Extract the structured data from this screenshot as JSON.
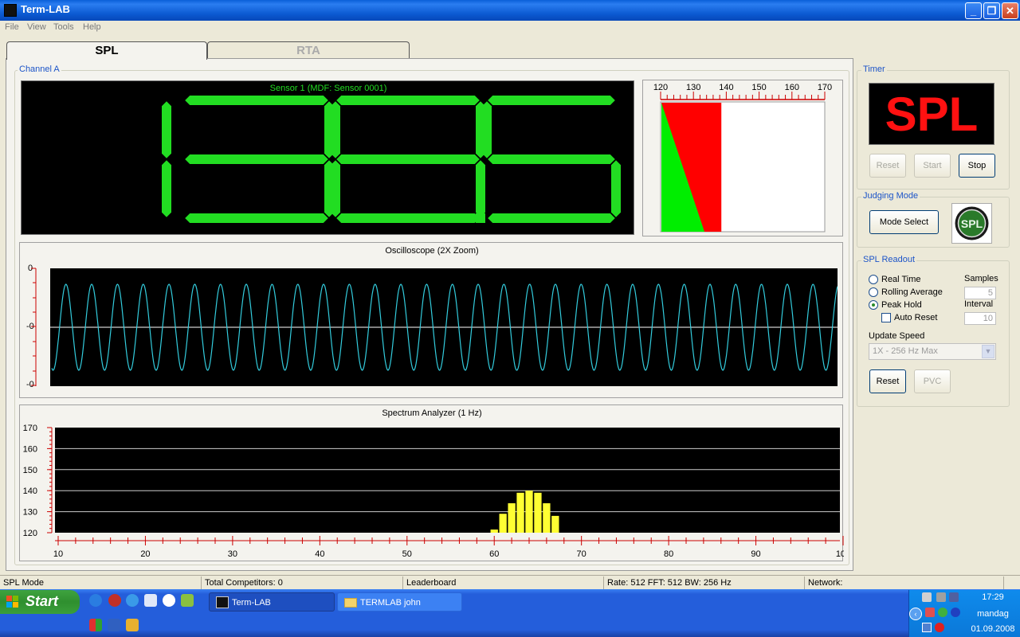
{
  "window": {
    "title": "Term-LAB"
  },
  "menu": [
    "File",
    "View",
    "Tools",
    "Help"
  ],
  "tabs": [
    {
      "label": "SPL"
    },
    {
      "label": "RTA"
    }
  ],
  "channel": {
    "label": "Channel A",
    "sensor": "Sensor 1 (MDF: Sensor 0001)",
    "digits": [
      "1",
      "3",
      "8"
    ],
    "decimal": "5"
  },
  "bar_meter": {
    "ticks": [
      "120",
      "130",
      "140",
      "150",
      "160",
      "170"
    ],
    "value": 138.5
  },
  "oscilloscope": {
    "title": "Oscilloscope (2X Zoom)",
    "y_labels": [
      "0",
      "-0",
      "-0"
    ]
  },
  "spectrum": {
    "title": "Spectrum Analyzer (1 Hz)"
  },
  "timer": {
    "label": "Timer",
    "display": "SPL",
    "reset": "Reset",
    "start": "Start",
    "stop": "Stop"
  },
  "judging": {
    "label": "Judging Mode",
    "mode_select": "Mode Select",
    "logo_text": "SPL"
  },
  "readout": {
    "label": "SPL Readout",
    "options": [
      "Real Time",
      "Rolling Average",
      "Peak Hold"
    ],
    "selected": "Peak Hold",
    "auto_reset": "Auto Reset",
    "samples_label": "Samples",
    "samples_value": "5",
    "interval_label": "Interval",
    "interval_value": "10",
    "update_speed_label": "Update Speed",
    "update_speed_value": "1X - 256 Hz Max",
    "reset": "Reset",
    "pvc": "PVC"
  },
  "statusbar": [
    "SPL Mode",
    "Total Competitors: 0",
    "Leaderboard",
    "Rate: 512  FFT: 512  BW: 256 Hz",
    "Network:"
  ],
  "taskbar": {
    "start": "Start",
    "tasks": [
      "Term-LAB",
      "TERMLAB john"
    ],
    "clock": {
      "time": "17:29",
      "day": "mandag",
      "date": "01.09.2008"
    }
  },
  "chart_data": {
    "type": "bar",
    "title": "Spectrum Analyzer (1 Hz)",
    "xlim": [
      10,
      100
    ],
    "ylim": [
      120,
      170
    ],
    "x_ticks": [
      "10",
      "20",
      "30",
      "40",
      "50",
      "60",
      "70",
      "80",
      "90",
      "100"
    ],
    "y_ticks": [
      "170",
      "160",
      "150",
      "140",
      "130",
      "120"
    ],
    "grid": true,
    "x": [
      60,
      61,
      62,
      63,
      64,
      65,
      66,
      67
    ],
    "values": [
      121.5,
      129,
      134,
      139,
      140,
      139,
      134,
      128
    ]
  },
  "colors": {
    "segment_on": "#22dd22",
    "bar_red": "#ff0000",
    "bar_green": "#00ee00",
    "scope_trace": "#33ccdd",
    "spectrum_bar": "#ffff33",
    "timer_text": "#ff1111"
  }
}
